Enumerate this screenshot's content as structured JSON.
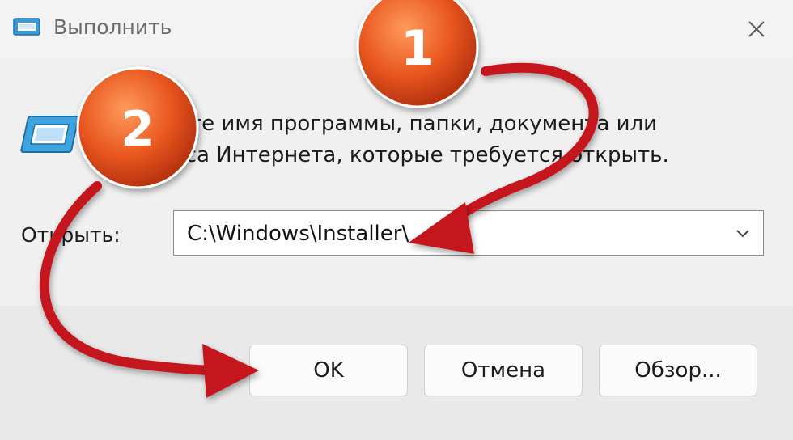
{
  "window": {
    "title": "Выполнить",
    "close_icon": "close-icon"
  },
  "prompt": {
    "text_line1": "Введите имя программы, папки, документа или",
    "text_line2": "ресурса Интернета, которые требуется открыть."
  },
  "open_field": {
    "label": "Открыть:",
    "value": "C:\\Windows\\Installer\\",
    "dropdown_icon": "chevron-down-icon"
  },
  "buttons": {
    "ok": "OK",
    "cancel": "Отмена",
    "browse": "Обзор..."
  },
  "annotations": {
    "step1": "1",
    "step2": "2",
    "arrow_color": "#c4161c",
    "badge_color": "#e8561f"
  }
}
